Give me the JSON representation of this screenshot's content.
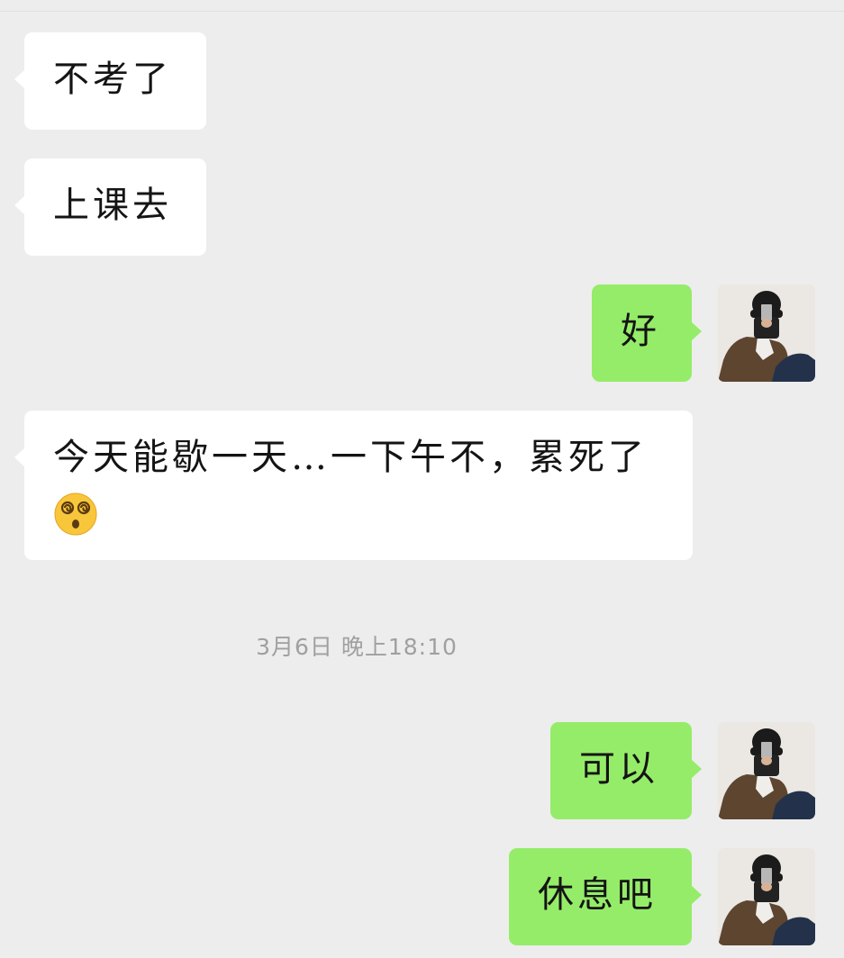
{
  "messages": [
    {
      "side": "in",
      "text": "不考了"
    },
    {
      "side": "in",
      "text": "上课去"
    },
    {
      "side": "out",
      "text": "好"
    },
    {
      "side": "in",
      "text": "今天能歇一天…一下午不，累死了",
      "emoji": "dizzy-face-emoji"
    },
    {
      "side": "out",
      "text": "可以"
    },
    {
      "side": "out",
      "text": "休息吧"
    }
  ],
  "timestamp": "3月6日 晚上18:10",
  "colors": {
    "background": "#ededed",
    "incoming_bubble": "#ffffff",
    "outgoing_bubble": "#95ec69",
    "timestamp_text": "#a0a0a0",
    "emoji_face": "#f8c63a"
  },
  "icons": {
    "avatar": "user-avatar-photo",
    "emoji": "dizzy-face-emoji"
  }
}
